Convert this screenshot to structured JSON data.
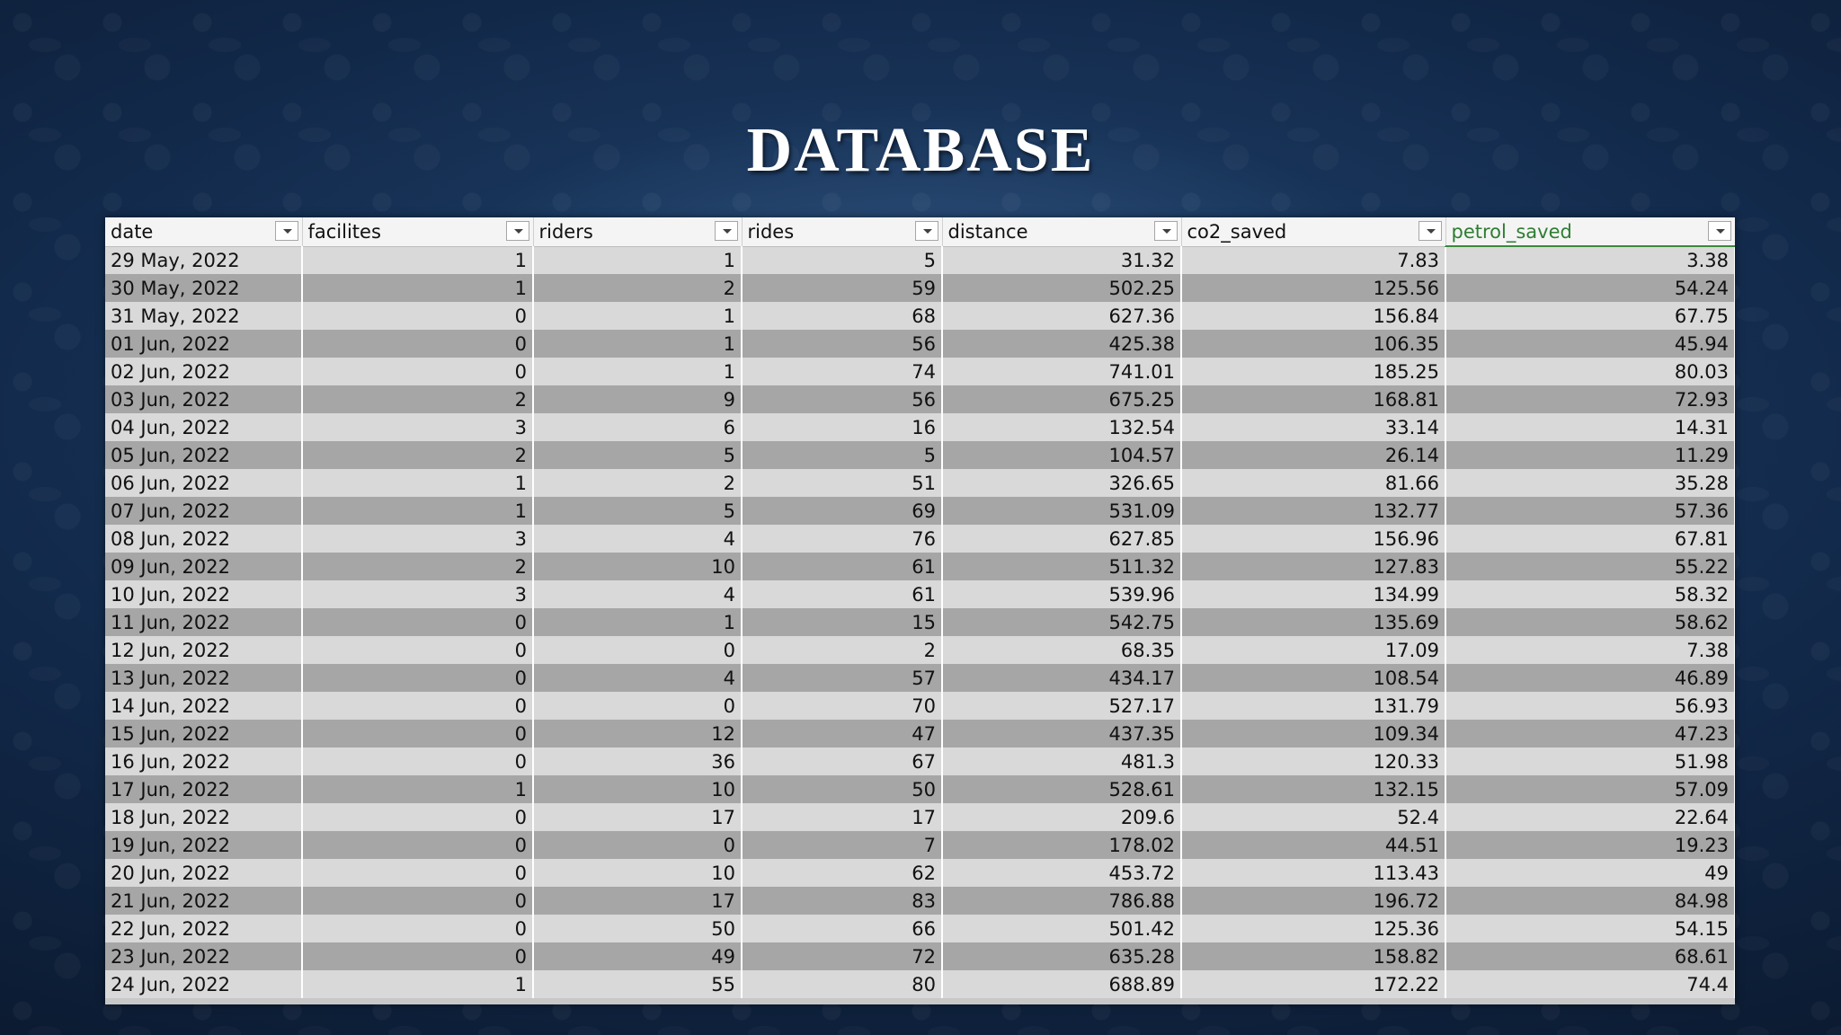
{
  "slide": {
    "title": "DATABASE"
  },
  "table": {
    "columns": [
      "date",
      "facilites",
      "riders",
      "rides",
      "distance",
      "co2_saved",
      "petrol_saved"
    ],
    "active_column": "petrol_saved",
    "rows": [
      [
        "29 May, 2022",
        "1",
        "1",
        "5",
        "31.32",
        "7.83",
        "3.38"
      ],
      [
        "30 May, 2022",
        "1",
        "2",
        "59",
        "502.25",
        "125.56",
        "54.24"
      ],
      [
        "31 May, 2022",
        "0",
        "1",
        "68",
        "627.36",
        "156.84",
        "67.75"
      ],
      [
        "01 Jun, 2022",
        "0",
        "1",
        "56",
        "425.38",
        "106.35",
        "45.94"
      ],
      [
        "02 Jun, 2022",
        "0",
        "1",
        "74",
        "741.01",
        "185.25",
        "80.03"
      ],
      [
        "03 Jun, 2022",
        "2",
        "9",
        "56",
        "675.25",
        "168.81",
        "72.93"
      ],
      [
        "04 Jun, 2022",
        "3",
        "6",
        "16",
        "132.54",
        "33.14",
        "14.31"
      ],
      [
        "05 Jun, 2022",
        "2",
        "5",
        "5",
        "104.57",
        "26.14",
        "11.29"
      ],
      [
        "06 Jun, 2022",
        "1",
        "2",
        "51",
        "326.65",
        "81.66",
        "35.28"
      ],
      [
        "07 Jun, 2022",
        "1",
        "5",
        "69",
        "531.09",
        "132.77",
        "57.36"
      ],
      [
        "08 Jun, 2022",
        "3",
        "4",
        "76",
        "627.85",
        "156.96",
        "67.81"
      ],
      [
        "09 Jun, 2022",
        "2",
        "10",
        "61",
        "511.32",
        "127.83",
        "55.22"
      ],
      [
        "10 Jun, 2022",
        "3",
        "4",
        "61",
        "539.96",
        "134.99",
        "58.32"
      ],
      [
        "11 Jun, 2022",
        "0",
        "1",
        "15",
        "542.75",
        "135.69",
        "58.62"
      ],
      [
        "12 Jun, 2022",
        "0",
        "0",
        "2",
        "68.35",
        "17.09",
        "7.38"
      ],
      [
        "13 Jun, 2022",
        "0",
        "4",
        "57",
        "434.17",
        "108.54",
        "46.89"
      ],
      [
        "14 Jun, 2022",
        "0",
        "0",
        "70",
        "527.17",
        "131.79",
        "56.93"
      ],
      [
        "15 Jun, 2022",
        "0",
        "12",
        "47",
        "437.35",
        "109.34",
        "47.23"
      ],
      [
        "16 Jun, 2022",
        "0",
        "36",
        "67",
        "481.3",
        "120.33",
        "51.98"
      ],
      [
        "17 Jun, 2022",
        "1",
        "10",
        "50",
        "528.61",
        "132.15",
        "57.09"
      ],
      [
        "18 Jun, 2022",
        "0",
        "17",
        "17",
        "209.6",
        "52.4",
        "22.64"
      ],
      [
        "19 Jun, 2022",
        "0",
        "0",
        "7",
        "178.02",
        "44.51",
        "19.23"
      ],
      [
        "20 Jun, 2022",
        "0",
        "10",
        "62",
        "453.72",
        "113.43",
        "49"
      ],
      [
        "21 Jun, 2022",
        "0",
        "17",
        "83",
        "786.88",
        "196.72",
        "84.98"
      ],
      [
        "22 Jun, 2022",
        "0",
        "50",
        "66",
        "501.42",
        "125.36",
        "54.15"
      ],
      [
        "23 Jun, 2022",
        "0",
        "49",
        "72",
        "635.28",
        "158.82",
        "68.61"
      ],
      [
        "24 Jun, 2022",
        "1",
        "55",
        "80",
        "688.89",
        "172.22",
        "74.4"
      ]
    ]
  },
  "icons": {
    "filter": "chevron-down-icon"
  },
  "colors": {
    "background_dark": "#0b1a30",
    "header_bg": "#f4f4f4",
    "row_light": "#d9d9d9",
    "row_dark": "#a6a6a6",
    "active_header_text": "#2e7d32",
    "title_text": "#ffffff"
  }
}
